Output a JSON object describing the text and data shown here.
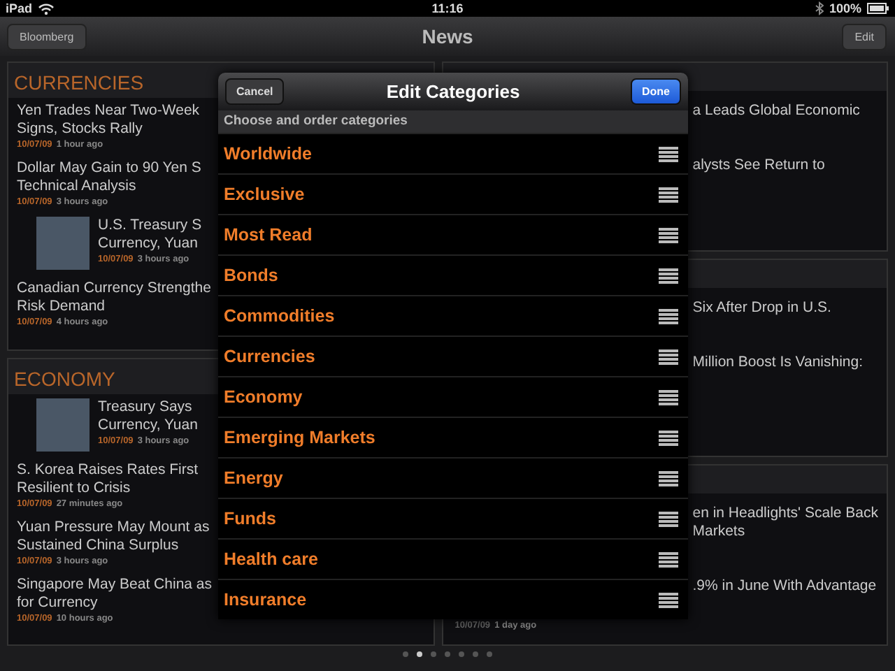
{
  "status_bar": {
    "device": "iPad",
    "time": "11:16",
    "battery": "100%"
  },
  "nav_bar": {
    "back": "Bloomberg",
    "title": "News",
    "edit": "Edit"
  },
  "left_panels": [
    {
      "title": "CURRENCIES",
      "articles": [
        {
          "lines": [
            "Yen Trades Near Two-Week",
            "Signs, Stocks Rally"
          ],
          "date": "10/07/09",
          "ago": "1 hour ago",
          "photo": false
        },
        {
          "lines": [
            "Dollar May Gain to 90 Yen S",
            "Technical Analysis"
          ],
          "date": "10/07/09",
          "ago": "3 hours ago",
          "photo": false
        },
        {
          "lines": [
            "U.S. Treasury S",
            "Currency, Yuan"
          ],
          "date": "10/07/09",
          "ago": "3 hours ago",
          "photo": true
        },
        {
          "lines": [
            "Canadian Currency Strengthe",
            "Risk Demand"
          ],
          "date": "10/07/09",
          "ago": "4 hours ago",
          "photo": false
        }
      ]
    },
    {
      "title": "ECONOMY",
      "articles": [
        {
          "lines": [
            "Treasury Says",
            "Currency, Yuan"
          ],
          "date": "10/07/09",
          "ago": "3 hours ago",
          "photo": true
        },
        {
          "lines": [
            "S. Korea Raises Rates First",
            "Resilient to Crisis"
          ],
          "date": "10/07/09",
          "ago": "27 minutes ago",
          "photo": false
        },
        {
          "lines": [
            "Yuan Pressure May Mount as",
            "Sustained China Surplus"
          ],
          "date": "10/07/09",
          "ago": "3 hours ago",
          "photo": false
        },
        {
          "lines": [
            "Singapore May Beat China as",
            "for Currency"
          ],
          "date": "10/07/09",
          "ago": "10 hours ago",
          "photo": false
        }
      ]
    }
  ],
  "right_panels": [
    {
      "articles": [
        {
          "lines": [
            "a Leads Global Economic"
          ]
        },
        {
          "lines": [
            "alysts See Return to"
          ]
        }
      ]
    },
    {
      "articles": [
        {
          "lines": [
            "Six After Drop in U.S."
          ]
        },
        {
          "lines": [
            "Million Boost Is Vanishing:"
          ]
        }
      ]
    },
    {
      "articles": [
        {
          "lines": [
            "en in Headlights' Scale Back",
            "Markets"
          ]
        },
        {
          "lines": [
            ".9% in June With Advantage"
          ]
        }
      ],
      "date": "10/07/09",
      "ago": "1 day ago"
    }
  ],
  "modal": {
    "cancel": "Cancel",
    "title": "Edit Categories",
    "done": "Done",
    "subtitle": "Choose and order categories",
    "categories": [
      "Worldwide",
      "Exclusive",
      "Most Read",
      "Bonds",
      "Commodities",
      "Currencies",
      "Economy",
      "Emerging Markets",
      "Energy",
      "Funds",
      "Health care",
      "Insurance"
    ]
  },
  "page_dots": [
    {
      "selected": false
    },
    {
      "selected": true
    },
    {
      "selected": false
    },
    {
      "selected": false
    },
    {
      "selected": false
    },
    {
      "selected": false
    },
    {
      "selected": false
    }
  ]
}
